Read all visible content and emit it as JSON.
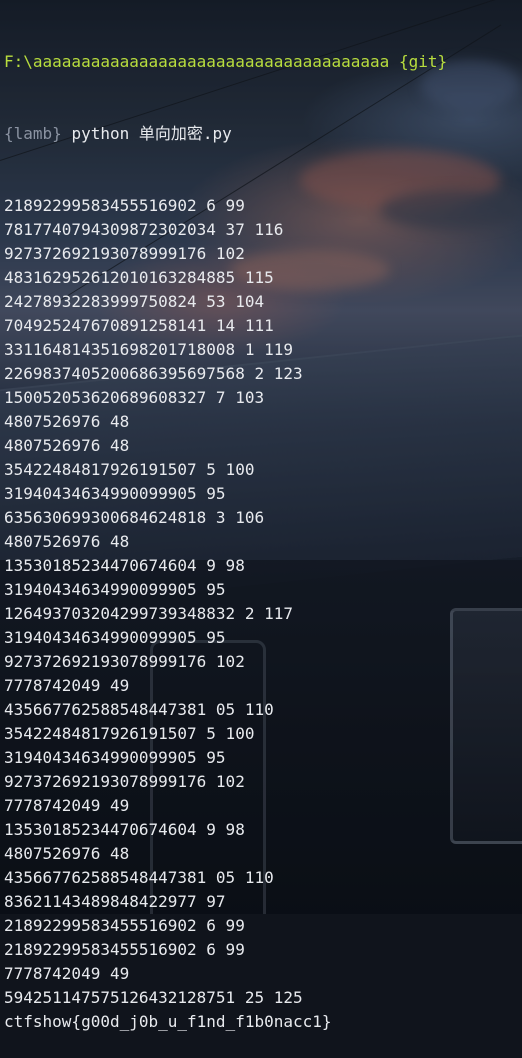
{
  "terminal": {
    "prompt_path": "F:\\aaaaaaaaaaaaaaaaaaaaaaaaaaaaaaaaaaaaa",
    "prompt_branch": "{git}",
    "env_name": "{lamb}",
    "command": "python 单向加密.py",
    "output_lines": [
      "21892299583455516902 6 99",
      "7817740794309872302034 37 116",
      "927372692193078999176 102",
      "483162952612010163284885 115",
      "24278932283999750824 53 104",
      "704925247670891258141 14 111",
      "331164814351698201718008 1 119",
      "2269837405200686395697568 2 123",
      "150052053620689608327 7 103",
      "4807526976 48",
      "4807526976 48",
      "35422484817926191507 5 100",
      "31940434634990099905 95",
      "635630699300684624818 3 106",
      "4807526976 48",
      "13530185234470674604 9 98",
      "31940434634990099905 95",
      "126493703204299739348832 2 117",
      "31940434634990099905 95",
      "927372692193078999176 102",
      "7778742049 49",
      "435667762588548447381 05 110",
      "35422484817926191507 5 100",
      "31940434634990099905 95",
      "927372692193078999176 102",
      "7778742049 49",
      "13530185234470674604 9 98",
      "4807526976 48",
      "435667762588548447381 05 110",
      "83621143489848422977 97",
      "21892299583455516902 6 99",
      "21892299583455516902 6 99",
      "7778742049 49",
      "594251147575126432128751 25 125",
      "ctfshow{g00d_j0b_u_f1nd_f1b0nacc1}"
    ]
  },
  "colors": {
    "prompt": "#b8dd3e",
    "env": "#8b93a2",
    "text": "#e8eaee"
  }
}
